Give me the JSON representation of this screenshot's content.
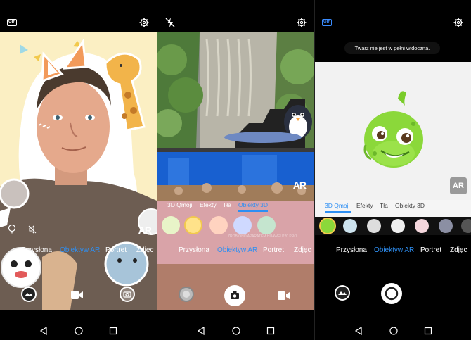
{
  "panels": [
    {
      "gif_label": "GIF",
      "modes": [
        "Przysłona",
        "Obiektyw AR",
        "Portret",
        "Zdjęc"
      ],
      "active_mode_index": 1,
      "ar_badge": "AR"
    },
    {
      "tabs": [
        "3D Qmoji",
        "Efekty",
        "Tła",
        "Obiekty 3D"
      ],
      "active_tab_index": 3,
      "modes": [
        "Przysłona",
        "Obiektyw AR",
        "Portret",
        "Zdjęc"
      ],
      "active_mode_index": 1,
      "ar_badge": "AR",
      "watermark": "ZROBIONO APARATEM HUAWEI P20 PRO"
    },
    {
      "gif_label": "GIF",
      "toast": "Twarz nie jest w pełni widoczna.",
      "tabs": [
        "3D Qmoji",
        "Efekty",
        "Tła",
        "Obiekty 3D"
      ],
      "active_tab_index": 0,
      "modes": [
        "Przysłona",
        "Obiektyw AR",
        "Portret",
        "Zdjęc"
      ],
      "active_mode_index": 1,
      "ar_badge": "AR"
    }
  ],
  "colors": {
    "accent": "#2e8ff3",
    "background": "#000000",
    "ar_white_bg": "#f2f2f2"
  },
  "icons": [
    "gif-icon",
    "gear-icon",
    "flash-off-icon",
    "gallery-icon",
    "shutter-icon",
    "video-icon",
    "back-nav-icon",
    "home-nav-icon",
    "recents-nav-icon"
  ]
}
